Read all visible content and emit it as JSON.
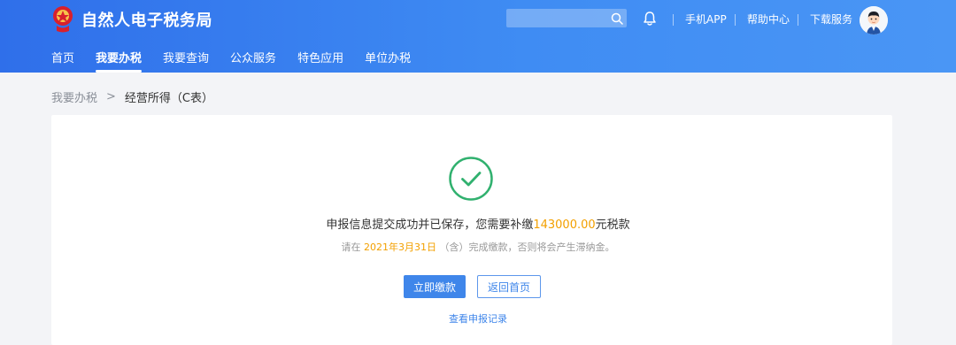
{
  "header": {
    "logo_text": "自然人电子税务局",
    "search": {
      "placeholder": "",
      "value": ""
    },
    "links": {
      "mobile_app": "手机APP",
      "help_center": "帮助中心",
      "download_service": "下载服务"
    },
    "nav": [
      {
        "label": "首页",
        "active": false
      },
      {
        "label": "我要办税",
        "active": true
      },
      {
        "label": "我要查询",
        "active": false
      },
      {
        "label": "公众服务",
        "active": false
      },
      {
        "label": "特色应用",
        "active": false
      },
      {
        "label": "单位办税",
        "active": false
      }
    ]
  },
  "breadcrumb": {
    "parent": "我要办税",
    "separator": ">",
    "current": "经营所得（C表）"
  },
  "result": {
    "message_prefix": "申报信息提交成功并已保存，您需要补缴",
    "amount": "143000.00",
    "message_suffix": "元税款",
    "deadline_prefix": "请在 ",
    "deadline": "2021年3月31日",
    "deadline_suffix": " （含）完成缴款，否则将会产生滞纳金。",
    "pay_button": "立即缴款",
    "home_button": "返回首页",
    "record_link": "查看申报记录"
  },
  "icons": {
    "logo": "tax-emblem-icon",
    "search": "search-icon",
    "notification": "bell-icon",
    "avatar": "user-avatar-icon",
    "success": "check-circle-icon"
  },
  "colors": {
    "header_blue": "#3f86ea",
    "success_green": "#31b16f",
    "highlight_orange": "#f3a000",
    "link_blue": "#3f86ea",
    "page_background": "#f3f4f7"
  }
}
